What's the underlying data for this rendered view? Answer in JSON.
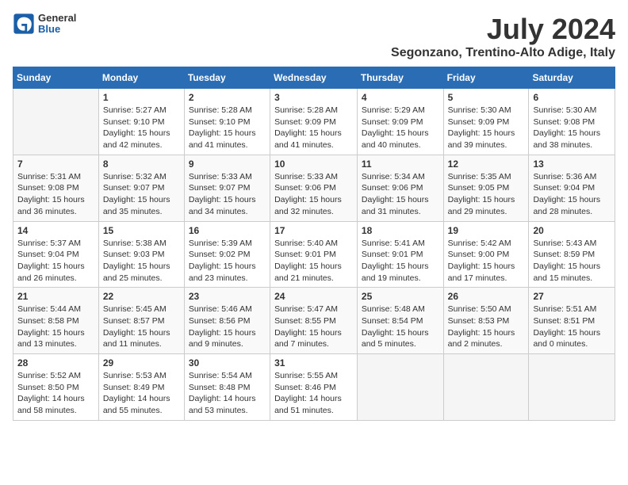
{
  "logo": {
    "line1": "General",
    "line2": "Blue"
  },
  "title": "July 2024",
  "subtitle": "Segonzano, Trentino-Alto Adige, Italy",
  "days_of_week": [
    "Sunday",
    "Monday",
    "Tuesday",
    "Wednesday",
    "Thursday",
    "Friday",
    "Saturday"
  ],
  "weeks": [
    [
      {
        "day": "",
        "info": ""
      },
      {
        "day": "1",
        "info": "Sunrise: 5:27 AM\nSunset: 9:10 PM\nDaylight: 15 hours\nand 42 minutes."
      },
      {
        "day": "2",
        "info": "Sunrise: 5:28 AM\nSunset: 9:10 PM\nDaylight: 15 hours\nand 41 minutes."
      },
      {
        "day": "3",
        "info": "Sunrise: 5:28 AM\nSunset: 9:09 PM\nDaylight: 15 hours\nand 41 minutes."
      },
      {
        "day": "4",
        "info": "Sunrise: 5:29 AM\nSunset: 9:09 PM\nDaylight: 15 hours\nand 40 minutes."
      },
      {
        "day": "5",
        "info": "Sunrise: 5:30 AM\nSunset: 9:09 PM\nDaylight: 15 hours\nand 39 minutes."
      },
      {
        "day": "6",
        "info": "Sunrise: 5:30 AM\nSunset: 9:08 PM\nDaylight: 15 hours\nand 38 minutes."
      }
    ],
    [
      {
        "day": "7",
        "info": "Sunrise: 5:31 AM\nSunset: 9:08 PM\nDaylight: 15 hours\nand 36 minutes."
      },
      {
        "day": "8",
        "info": "Sunrise: 5:32 AM\nSunset: 9:07 PM\nDaylight: 15 hours\nand 35 minutes."
      },
      {
        "day": "9",
        "info": "Sunrise: 5:33 AM\nSunset: 9:07 PM\nDaylight: 15 hours\nand 34 minutes."
      },
      {
        "day": "10",
        "info": "Sunrise: 5:33 AM\nSunset: 9:06 PM\nDaylight: 15 hours\nand 32 minutes."
      },
      {
        "day": "11",
        "info": "Sunrise: 5:34 AM\nSunset: 9:06 PM\nDaylight: 15 hours\nand 31 minutes."
      },
      {
        "day": "12",
        "info": "Sunrise: 5:35 AM\nSunset: 9:05 PM\nDaylight: 15 hours\nand 29 minutes."
      },
      {
        "day": "13",
        "info": "Sunrise: 5:36 AM\nSunset: 9:04 PM\nDaylight: 15 hours\nand 28 minutes."
      }
    ],
    [
      {
        "day": "14",
        "info": "Sunrise: 5:37 AM\nSunset: 9:04 PM\nDaylight: 15 hours\nand 26 minutes."
      },
      {
        "day": "15",
        "info": "Sunrise: 5:38 AM\nSunset: 9:03 PM\nDaylight: 15 hours\nand 25 minutes."
      },
      {
        "day": "16",
        "info": "Sunrise: 5:39 AM\nSunset: 9:02 PM\nDaylight: 15 hours\nand 23 minutes."
      },
      {
        "day": "17",
        "info": "Sunrise: 5:40 AM\nSunset: 9:01 PM\nDaylight: 15 hours\nand 21 minutes."
      },
      {
        "day": "18",
        "info": "Sunrise: 5:41 AM\nSunset: 9:01 PM\nDaylight: 15 hours\nand 19 minutes."
      },
      {
        "day": "19",
        "info": "Sunrise: 5:42 AM\nSunset: 9:00 PM\nDaylight: 15 hours\nand 17 minutes."
      },
      {
        "day": "20",
        "info": "Sunrise: 5:43 AM\nSunset: 8:59 PM\nDaylight: 15 hours\nand 15 minutes."
      }
    ],
    [
      {
        "day": "21",
        "info": "Sunrise: 5:44 AM\nSunset: 8:58 PM\nDaylight: 15 hours\nand 13 minutes."
      },
      {
        "day": "22",
        "info": "Sunrise: 5:45 AM\nSunset: 8:57 PM\nDaylight: 15 hours\nand 11 minutes."
      },
      {
        "day": "23",
        "info": "Sunrise: 5:46 AM\nSunset: 8:56 PM\nDaylight: 15 hours\nand 9 minutes."
      },
      {
        "day": "24",
        "info": "Sunrise: 5:47 AM\nSunset: 8:55 PM\nDaylight: 15 hours\nand 7 minutes."
      },
      {
        "day": "25",
        "info": "Sunrise: 5:48 AM\nSunset: 8:54 PM\nDaylight: 15 hours\nand 5 minutes."
      },
      {
        "day": "26",
        "info": "Sunrise: 5:50 AM\nSunset: 8:53 PM\nDaylight: 15 hours\nand 2 minutes."
      },
      {
        "day": "27",
        "info": "Sunrise: 5:51 AM\nSunset: 8:51 PM\nDaylight: 15 hours\nand 0 minutes."
      }
    ],
    [
      {
        "day": "28",
        "info": "Sunrise: 5:52 AM\nSunset: 8:50 PM\nDaylight: 14 hours\nand 58 minutes."
      },
      {
        "day": "29",
        "info": "Sunrise: 5:53 AM\nSunset: 8:49 PM\nDaylight: 14 hours\nand 55 minutes."
      },
      {
        "day": "30",
        "info": "Sunrise: 5:54 AM\nSunset: 8:48 PM\nDaylight: 14 hours\nand 53 minutes."
      },
      {
        "day": "31",
        "info": "Sunrise: 5:55 AM\nSunset: 8:46 PM\nDaylight: 14 hours\nand 51 minutes."
      },
      {
        "day": "",
        "info": ""
      },
      {
        "day": "",
        "info": ""
      },
      {
        "day": "",
        "info": ""
      }
    ]
  ]
}
